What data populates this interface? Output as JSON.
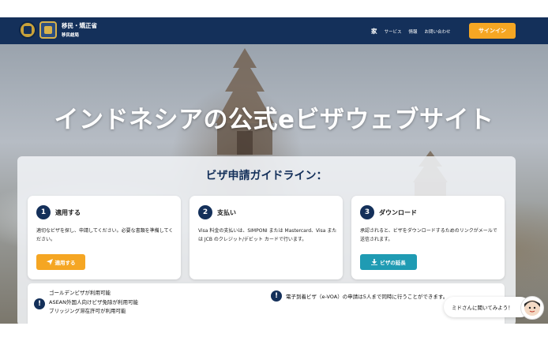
{
  "header": {
    "brand_line1": "移民・矯正省",
    "brand_line2": "移民総局",
    "nav": [
      {
        "label": "家"
      },
      {
        "label": "サービス"
      },
      {
        "label": "情報"
      },
      {
        "label": "お問い合わせ"
      }
    ],
    "signin_label": "サインイン"
  },
  "hero": {
    "title": "インドネシアの公式eビザウェブサイト"
  },
  "guidelines": {
    "title": "ビザ申請ガイドライン：",
    "cards": [
      {
        "number": "1",
        "title": "適用する",
        "text": "適切なビザを探し、申請してください。必要な書類を準備してください。",
        "button": "適用する",
        "button_icon": "send-icon"
      },
      {
        "number": "2",
        "title": "支払い",
        "text": "Visa 料金の支払いは、SIMPONI または Mastercard、Visa または JCB のクレジット/デビット カードで行います。"
      },
      {
        "number": "3",
        "title": "ダウンロード",
        "text": "承認されると、ビザをダウンロードするためのリンクがメールで送信されます。",
        "button": "ビザの延長",
        "button_icon": "download-icon"
      }
    ]
  },
  "info": {
    "left_items": [
      "ゴールデンビザが利用可能",
      "ASEAN外国人向けビザ免除が利用可能",
      "ブリッジング滞在許可が利用可能"
    ],
    "right_item": "電子到着ビザ（e-VOA）の申請は5人まで同時に行うことができます。"
  },
  "chat": {
    "prompt": "ミドさんに聞いてみよう！"
  },
  "colors": {
    "navy": "#14305a",
    "accent_orange": "#f5a623",
    "teal": "#1f9bb3"
  }
}
